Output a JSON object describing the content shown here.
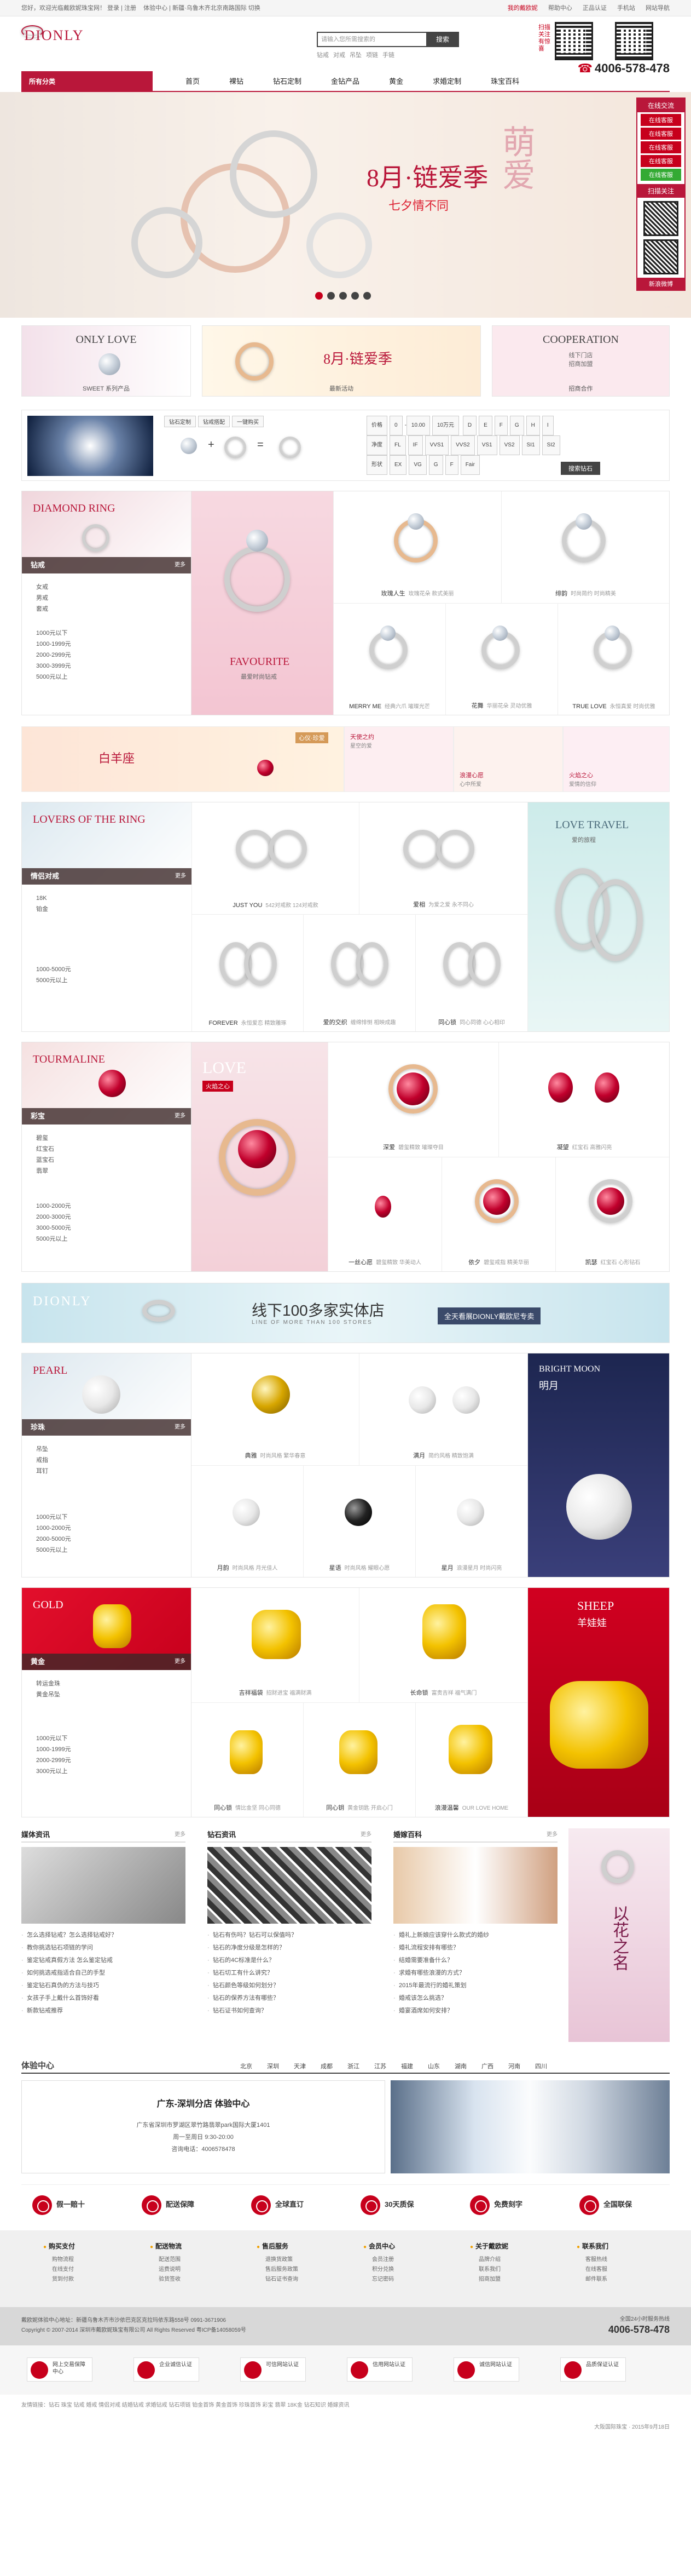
{
  "topbar": {
    "left": "您好，欢迎光临戴欧妮珠宝网！ 登录 | 注册",
    "center": "体验中心 | 新疆·乌鲁木齐北京南路国际 切换",
    "links": [
      "我的戴欧妮",
      "帮助中心",
      "正品认证",
      "手机站",
      "网站导航"
    ]
  },
  "logo": {
    "name": "DIONLY"
  },
  "search": {
    "placeholder": "请输入您所需搜索的",
    "button": "搜索",
    "hot": [
      "钻戒",
      "对戒",
      "吊坠",
      "项链",
      "手链"
    ]
  },
  "qr_text": "扫描关注有惊喜",
  "hotline": "4006-578-478",
  "nav": {
    "category": "所有分类",
    "items": [
      "首页",
      "裸钻",
      "钻石定制",
      "金钻产品",
      "黄金",
      "求婚定制",
      "珠宝百科"
    ]
  },
  "banner": {
    "title": "8月·链爱季",
    "subtitle": "七夕情不同",
    "side": "萌爱"
  },
  "sidebar": {
    "title": "在线交流",
    "items": [
      "在线客服",
      "在线客服",
      "在线客服",
      "在线客服"
    ],
    "green": "在线客服",
    "qr_label": "扫描关注",
    "footer": "新浪微博"
  },
  "promo": [
    {
      "title": "ONLY LOVE",
      "caption": "SWEET 系列产品"
    },
    {
      "title": "8月·链爱季",
      "caption": "最新活动"
    },
    {
      "title": "COOPERATION",
      "sub": "线下门店",
      "sub2": "招商加盟",
      "caption": "招商合作"
    }
  ],
  "filter": {
    "labels": [
      "价格",
      "形状",
      "颜色",
      "净度"
    ],
    "prices": [
      "0",
      "10.00",
      "10万元"
    ],
    "colors": [
      "D",
      "E",
      "F",
      "G",
      "H",
      "I",
      "J",
      "K"
    ],
    "clarity": [
      "FL",
      "IF",
      "VVS1",
      "VVS2",
      "VS1",
      "VS2",
      "SI1",
      "SI2"
    ],
    "cut": [
      "EX",
      "VG",
      "G",
      "F",
      "Fair"
    ],
    "search": "搜索钻石",
    "tabs": [
      "钻石定制",
      "钻戒搭配",
      "一键购买"
    ]
  },
  "floors": [
    {
      "en": "DIAMOND RING",
      "cn": "钻戒",
      "more": "更多",
      "list": [
        "女戒",
        "男戒",
        "套戒"
      ],
      "price": [
        "1000元以下",
        "1000-1999元",
        "2000-2999元",
        "3000-3999元",
        "5000元以上"
      ],
      "feature": "FAVOURITE",
      "feature_sub": "最爱时尚钻戒",
      "items": [
        {
          "n": "玫瑰人生",
          "d": "玫瑰花朵 款式美丽"
        },
        {
          "n": "绯韵",
          "d": "时尚简约 时尚精美"
        },
        {
          "n": "MERRY ME",
          "d": "经典六爪 璀璨光芒"
        },
        {
          "n": "花舞",
          "d": "华丽花朵 灵动优雅"
        },
        {
          "n": "TRUE LOVE",
          "d": "永恒真爱 时尚优雅"
        }
      ]
    },
    {
      "en": "LOVERS OF THE RING",
      "cn": "情侣对戒",
      "more": "更多",
      "list": [
        "18K",
        "铂金"
      ],
      "price": [
        "1000-5000元",
        "5000元以上"
      ],
      "feature": "LOVE TRAVEL",
      "feature_sub": "爱的旅程",
      "items": [
        {
          "n": "JUST YOU",
          "d": "542对戒款 124对戒款"
        },
        {
          "n": "爱相",
          "d": "为爱之爱 永不同心"
        },
        {
          "n": "FOREVER",
          "d": "永恒爱恋 精致雕琢"
        },
        {
          "n": "爱的交织",
          "d": "缠绵悱恻 相映成趣"
        },
        {
          "n": "同心锁",
          "d": "同心同德 心心相印"
        }
      ]
    },
    {
      "en": "TOURMALINE",
      "cn": "彩宝",
      "more": "更多",
      "list": [
        "碧玺",
        "红宝石",
        "蓝宝石",
        "翡翠"
      ],
      "price": [
        "1000-2000元",
        "2000-3000元",
        "3000-5000元",
        "5000元以上"
      ],
      "feature": "LOVE",
      "feature_sub": "火焰之心",
      "items": [
        {
          "n": "深爱",
          "d": "碧玺精致 璀璨夺目"
        },
        {
          "n": "凝望",
          "d": "红宝石 高雅闪亮"
        },
        {
          "n": "一丝心愿",
          "d": "碧玺精致 华美动人"
        },
        {
          "n": "依夕",
          "d": "碧玺戒指 精美华丽"
        },
        {
          "n": "凯瑟",
          "d": "红宝石 心形钻石"
        }
      ]
    },
    {
      "en": "PEARL",
      "cn": "珍珠",
      "more": "更多",
      "list": [
        "吊坠",
        "戒指",
        "耳钉"
      ],
      "price": [
        "1000元以下",
        "1000-2000元",
        "2000-5000元",
        "5000元以上"
      ],
      "feature": "BRIGHT MOON",
      "feature_sub": "明月",
      "items": [
        {
          "n": "典雅",
          "d": "时尚风格 繁华春意"
        },
        {
          "n": "满月",
          "d": "简约风格 精致饱满"
        },
        {
          "n": "月韵",
          "d": "时尚风格 月光佳人"
        },
        {
          "n": "星语",
          "d": "时尚风格 耀眼心愿"
        },
        {
          "n": "星月",
          "d": "浪漫星月 时尚闪亮"
        }
      ]
    },
    {
      "en": "GOLD",
      "cn": "黄金",
      "more": "更多",
      "list": [
        "转运金珠",
        "黄金吊坠"
      ],
      "price": [
        "1000元以下",
        "1000-1999元",
        "2000-2999元",
        "3000元以上"
      ],
      "feature": "SHEEP",
      "feature_sub": "羊娃娃",
      "items": [
        {
          "n": "吉祥福袋",
          "d": "招财进宝 福满财满"
        },
        {
          "n": "长命锁",
          "d": "富贵吉祥 福气满门"
        },
        {
          "n": "同心锁",
          "d": "情比金坚 同心同德"
        },
        {
          "n": "同心钥",
          "d": "黄金钥匙 开启心门"
        },
        {
          "n": "浪漫温馨",
          "d": "OUR LOVE HOME"
        }
      ]
    }
  ],
  "mid_banners": [
    {
      "a": "白羊座",
      "b": "心仪·珍爱"
    },
    {
      "a": "天使之约",
      "b": "星空的爱"
    },
    {
      "a": "浪漫心愿",
      "b": "心中所爱"
    },
    {
      "a": "火焰之心",
      "b": "爱情的信仰"
    }
  ],
  "store": {
    "brand": "DIONLY",
    "big": "线下100多家实体店",
    "small": "LINE OF MORE THAN 100 STORES",
    "right": "全天看展DIONLY戴欧尼专卖"
  },
  "news": [
    {
      "title": "媒体资讯",
      "more": "更多",
      "items": [
        "怎么选择钻戒？怎么选择钻戒好？",
        "教你挑选钻石项链的学问",
        "鉴定钻戒真假方法 怎么鉴定钻戒",
        "如何挑选戒指适合自己的手型",
        "鉴定钻石真伪的方法与技巧",
        "女孩子手上戴什么首饰好看",
        "新款钻戒推荐"
      ]
    },
    {
      "title": "钻石资讯",
      "more": "更多",
      "items": [
        "钻石有伤吗？钻石可以保值吗？",
        "钻石的净度分级是怎样的？",
        "钻石的4C标准是什么？",
        "钻石切工有什么讲究？",
        "钻石颜色等级如何划分？",
        "钻石的保养方法有哪些？",
        "钻石证书如何查询？"
      ]
    },
    {
      "title": "婚嫁百科",
      "more": "更多",
      "items": [
        "婚礼上新娘应该穿什么款式的婚纱",
        "婚礼流程安排有哪些？",
        "结婚需要准备什么？",
        "求婚有哪些浪漫的方式？",
        "2015年最流行的婚礼策划",
        "婚戒该怎么挑选？",
        "婚宴酒席如何安排？"
      ]
    }
  ],
  "side_ad": "以花之名",
  "experience": {
    "title": "体验中心",
    "cities": [
      "北京",
      "深圳",
      "天津",
      "成都",
      "浙江",
      "江苏",
      "福建",
      "山东",
      "湖南",
      "广西",
      "河南",
      "四川"
    ],
    "shop": "广东-深圳分店 体验中心",
    "addr": "广东省深圳市罗湖区翠竹路翡翠park国际大厦1401",
    "hours": "周一至周日 9:30-20:00",
    "tel": "咨询电话：4006578478"
  },
  "services": [
    "假一赔十",
    "配送保障",
    "全球直订",
    "30天质保",
    "免费刻字",
    "全国联保"
  ],
  "footer_cols": [
    {
      "h": "购买支付",
      "p": [
        "购物流程",
        "在线支付",
        "货到付款"
      ]
    },
    {
      "h": "配送物流",
      "p": [
        "配送范围",
        "运费说明",
        "验货签收"
      ]
    },
    {
      "h": "售后服务",
      "p": [
        "退换货政策",
        "售后服务政策",
        "钻石证书查询"
      ]
    },
    {
      "h": "会员中心",
      "p": [
        "会员注册",
        "积分兑换",
        "忘记密码"
      ]
    },
    {
      "h": "关于戴欧妮",
      "p": [
        "品牌介绍",
        "联系我们",
        "招商加盟"
      ]
    },
    {
      "h": "联系我们",
      "p": [
        "客服热线",
        "在线客服",
        "邮件联系"
      ]
    }
  ],
  "footer_info": [
    "戴欧妮体验中心地址：新疆乌鲁木齐市沙依巴克区克拉玛依东路558号 0991-3671906",
    "Copyright © 2007-2014 深圳市戴欧妮珠宝有限公司 All Rights Reserved 粤ICP备14058059号"
  ],
  "footer_hotline_label": "全国24小时服务热线",
  "footer_hotline": "4006-578-478",
  "footer_badges": [
    "网上交易保障中心",
    "企业诚信认证",
    "可信网站认证",
    "信用网站认证",
    "诚信网站认证",
    "品质保证认证"
  ],
  "bottom_links": "友情链接：钻石 珠宝 钻戒 婚戒 情侣对戒 结婚钻戒 求婚钻戒 钻石项链 铂金首饰 黄金首饰 珍珠首饰 彩宝 翡翠 18K金 钻石知识 婚嫁资讯",
  "bottom_right": "大阪国际珠宝 · 2015年9月18日"
}
